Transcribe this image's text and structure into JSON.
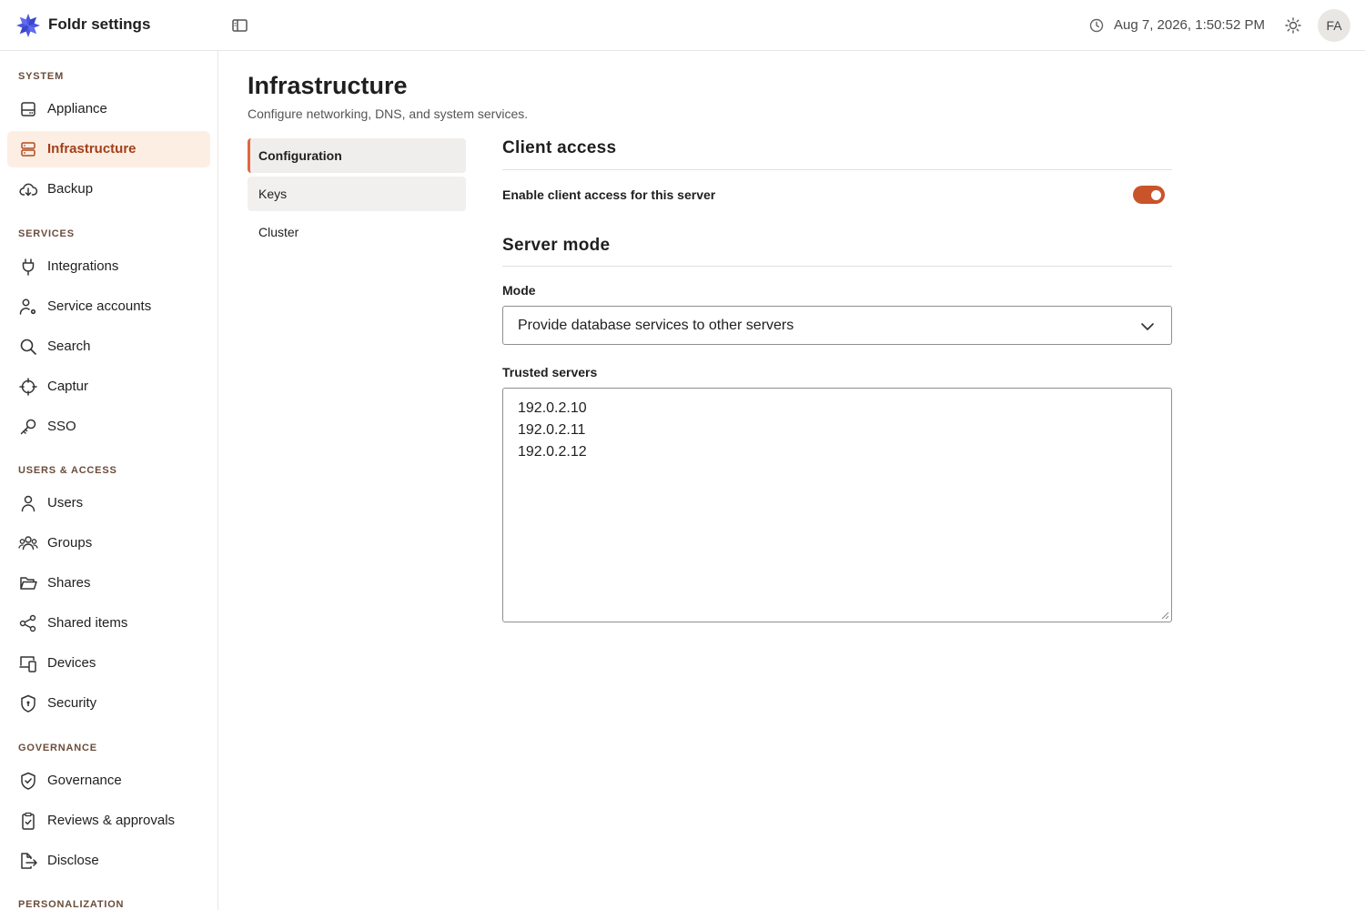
{
  "header": {
    "app_title": "Foldr settings",
    "datetime": "Aug 7, 2026, 1:50:52 PM",
    "avatar_initials": "FA",
    "logo_icon": "snowflake-logo-icon",
    "brand_color": "#4a57e0"
  },
  "sidebar": {
    "sections": {
      "system": "SYSTEM",
      "services": "SERVICES",
      "users_access": "USERS & ACCESS",
      "governance": "GOVERNANCE",
      "personalization": "PERSONALIZATION"
    },
    "items": [
      {
        "label": "Appliance",
        "icon": "appliance-icon"
      },
      {
        "label": "Infrastructure",
        "icon": "server-icon",
        "active": true
      },
      {
        "label": "Backup",
        "icon": "cloud-download-icon"
      },
      {
        "label": "Integrations",
        "icon": "plug-icon"
      },
      {
        "label": "Service accounts",
        "icon": "user-gear-icon"
      },
      {
        "label": "Search",
        "icon": "search-icon"
      },
      {
        "label": "Captur",
        "icon": "crosshair-icon"
      },
      {
        "label": "SSO",
        "icon": "key-icon"
      },
      {
        "label": "Users",
        "icon": "user-icon"
      },
      {
        "label": "Groups",
        "icon": "users-icon"
      },
      {
        "label": "Shares",
        "icon": "folder-open-icon"
      },
      {
        "label": "Shared items",
        "icon": "share-icon"
      },
      {
        "label": "Devices",
        "icon": "devices-icon"
      },
      {
        "label": "Security",
        "icon": "shield-icon"
      },
      {
        "label": "Governance",
        "icon": "shield-check-icon"
      },
      {
        "label": "Reviews & approvals",
        "icon": "clipboard-check-icon"
      },
      {
        "label": "Disclose",
        "icon": "file-export-icon"
      }
    ],
    "active_color": "#a3401a",
    "active_bg": "#fdeee4"
  },
  "main": {
    "title": "Infrastructure",
    "subtitle": "Configure networking, DNS, and system services.",
    "subnav": [
      {
        "label": "Configuration",
        "active": true
      },
      {
        "label": "Keys"
      },
      {
        "label": "Cluster"
      }
    ],
    "client_access": {
      "title": "Client access",
      "toggle_label": "Enable client access for this server",
      "enabled": true
    },
    "server_mode": {
      "title": "Server mode",
      "mode_label": "Mode",
      "mode_value": "Provide database services to other servers",
      "trusted_label": "Trusted servers",
      "trusted_servers": [
        "192.0.2.10",
        "192.0.2.11",
        "192.0.2.12"
      ]
    },
    "accent_color": "#c9532a"
  }
}
